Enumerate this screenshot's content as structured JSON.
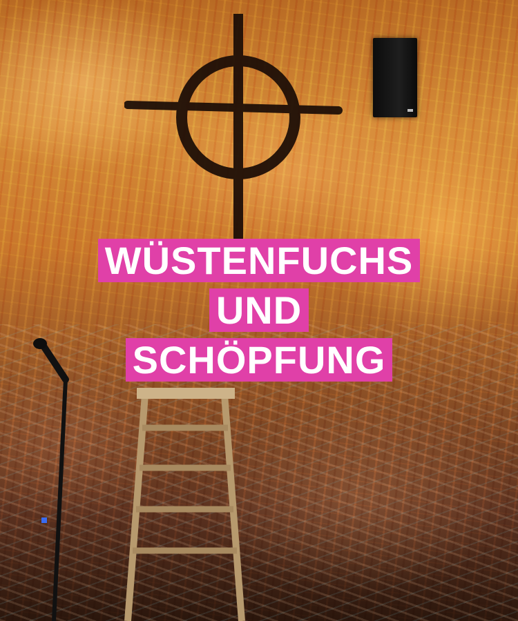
{
  "poster": {
    "title_lines": [
      "WÜSTENFUCHS",
      "UND",
      "SCHÖPFUNG"
    ],
    "highlight_color": "#e040a8",
    "text_color": "#ffffff"
  },
  "scene": {
    "background_desc_icons": [
      "cross-circle-icon",
      "speaker-icon",
      "ladder-icon",
      "microphone-icon"
    ]
  }
}
